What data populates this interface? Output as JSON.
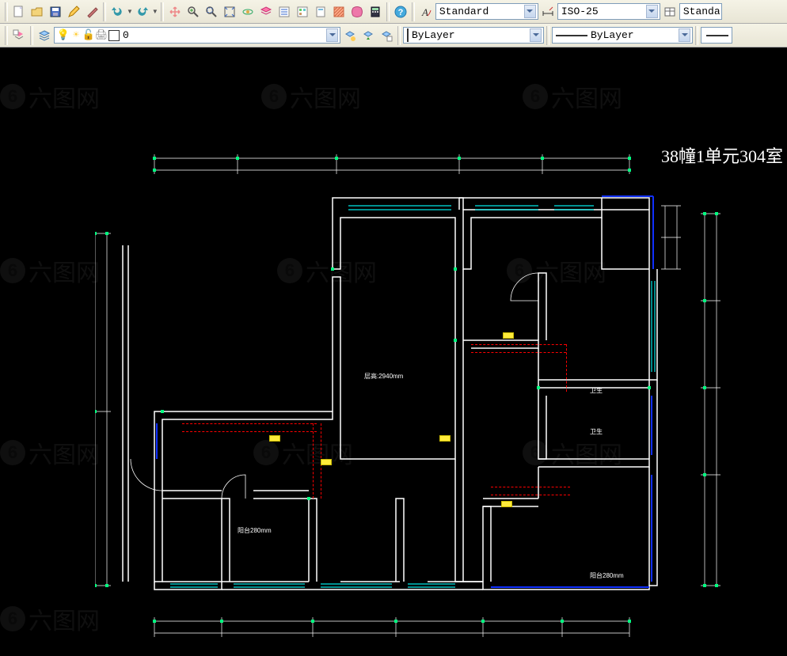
{
  "toolbar1": {
    "text_style_label": "Standard",
    "dim_style_label": "ISO-25",
    "table_style_label": "Standa"
  },
  "toolbar2": {
    "layer_combo": "0",
    "color_combo": "ByLayer",
    "linetype_combo": "ByLayer"
  },
  "drawing": {
    "title": "38幢1单元304室",
    "center_label": "层高:2940mm",
    "room_labels": [
      "卫生",
      "卫生",
      "阳台280mm",
      "阳台280mm"
    ]
  },
  "colors": {
    "wall": "#ffffff",
    "window": "#00e5e5",
    "door": "#1030ff",
    "dim_tick": "#00ff80",
    "tag": "#ffeb3b",
    "demolish": "#ff0000"
  },
  "icons": {
    "new": "new-file-icon",
    "open": "open-icon",
    "save": "save-icon",
    "pencil": "pencil-icon",
    "brush": "brush-icon",
    "undo": "undo-icon",
    "redo": "redo-icon",
    "pan": "pan-icon",
    "zoom-in": "zoom-in-icon",
    "zoom-win": "zoom-window-icon",
    "zoom-ext": "zoom-extents-icon",
    "orbit": "orbit-icon",
    "layers": "layers-icon",
    "props": "properties-icon",
    "blocks": "blocks-icon",
    "hatch": "hatch-icon",
    "region": "region-icon",
    "calc": "calc-icon",
    "help": "help-icon",
    "text-style": "text-style-icon",
    "dim-style": "dim-style-icon",
    "table-style": "table-style-icon",
    "layer-mgr": "layer-manager-icon",
    "layer-stack": "layer-stack-icon",
    "layer-pick": "layer-pick-icon",
    "layer-prev": "layer-prev-icon",
    "layer-state": "layer-state-icon",
    "bulb": "lightbulb-icon",
    "sun": "sun-icon",
    "lock": "lock-icon",
    "color-sw": "color-swatch-icon",
    "linetype": "linetype-icon",
    "lineweight": "lineweight-icon"
  }
}
